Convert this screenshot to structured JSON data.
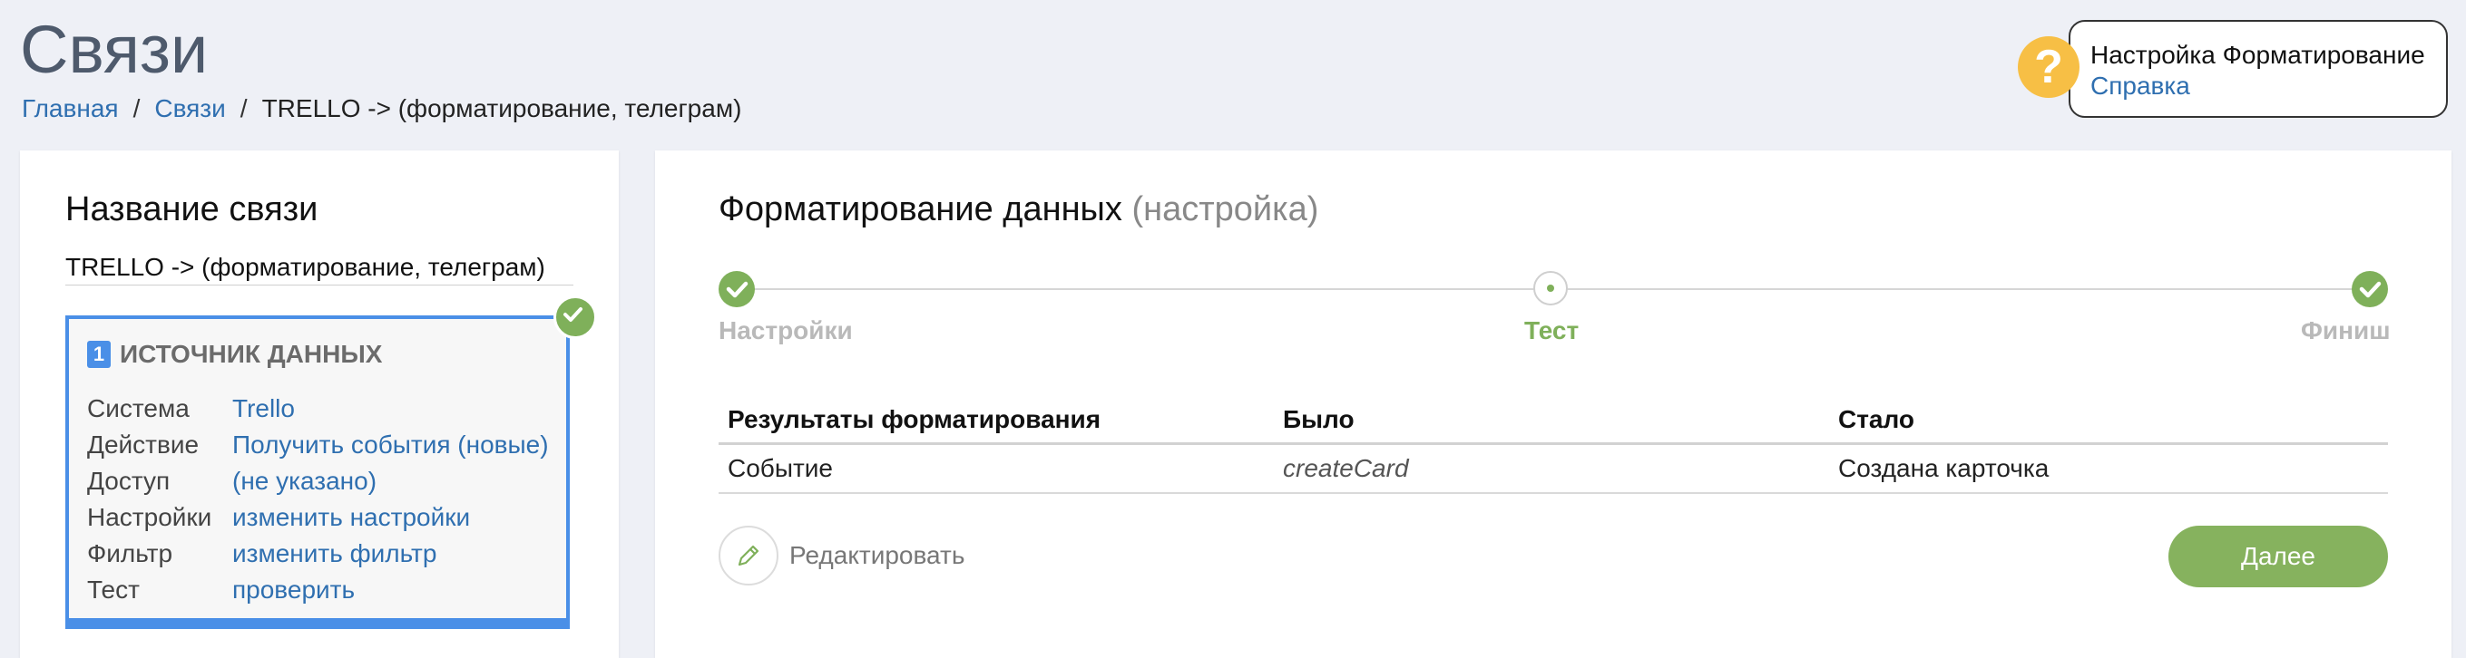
{
  "header": {
    "title": "Связи",
    "breadcrumb": {
      "home": "Главная",
      "links": "Связи",
      "current": "TRELLO -> (форматирование, телеграм)"
    }
  },
  "help": {
    "icon": "question-icon",
    "title": "Настройка Форматирование",
    "link": "Справка"
  },
  "left_panel": {
    "title": "Название связи",
    "connection_name": "TRELLO -> (форматирование, телеграм)",
    "source": {
      "number": "1",
      "header": "ИСТОЧНИК ДАННЫХ",
      "fields": [
        {
          "label": "Система",
          "value": "Trello"
        },
        {
          "label": "Действие",
          "value": "Получить события (новые)"
        },
        {
          "label": "Доступ",
          "value": "(не указано)"
        },
        {
          "label": "Настройки",
          "value": "изменить настройки"
        },
        {
          "label": "Фильтр",
          "value": "изменить фильтр"
        },
        {
          "label": "Тест",
          "value": "проверить"
        }
      ]
    }
  },
  "main": {
    "title": "Форматирование данных",
    "title_suffix": "(настройка)",
    "steps": [
      {
        "label": "Настройки",
        "state": "done"
      },
      {
        "label": "Тест",
        "state": "current"
      },
      {
        "label": "Финиш",
        "state": "done"
      }
    ],
    "table": {
      "columns": [
        "Результаты форматирования",
        "Было",
        "Стало"
      ],
      "rows": [
        [
          "Событие",
          "createCard",
          "Создана карточка"
        ]
      ]
    },
    "edit_label": "Редактировать",
    "next_label": "Далее"
  },
  "colors": {
    "accent_green": "#86b25e",
    "link_blue": "#2f6fb0",
    "source_border": "#4a8fe7",
    "help_yellow": "#f7bf45"
  }
}
